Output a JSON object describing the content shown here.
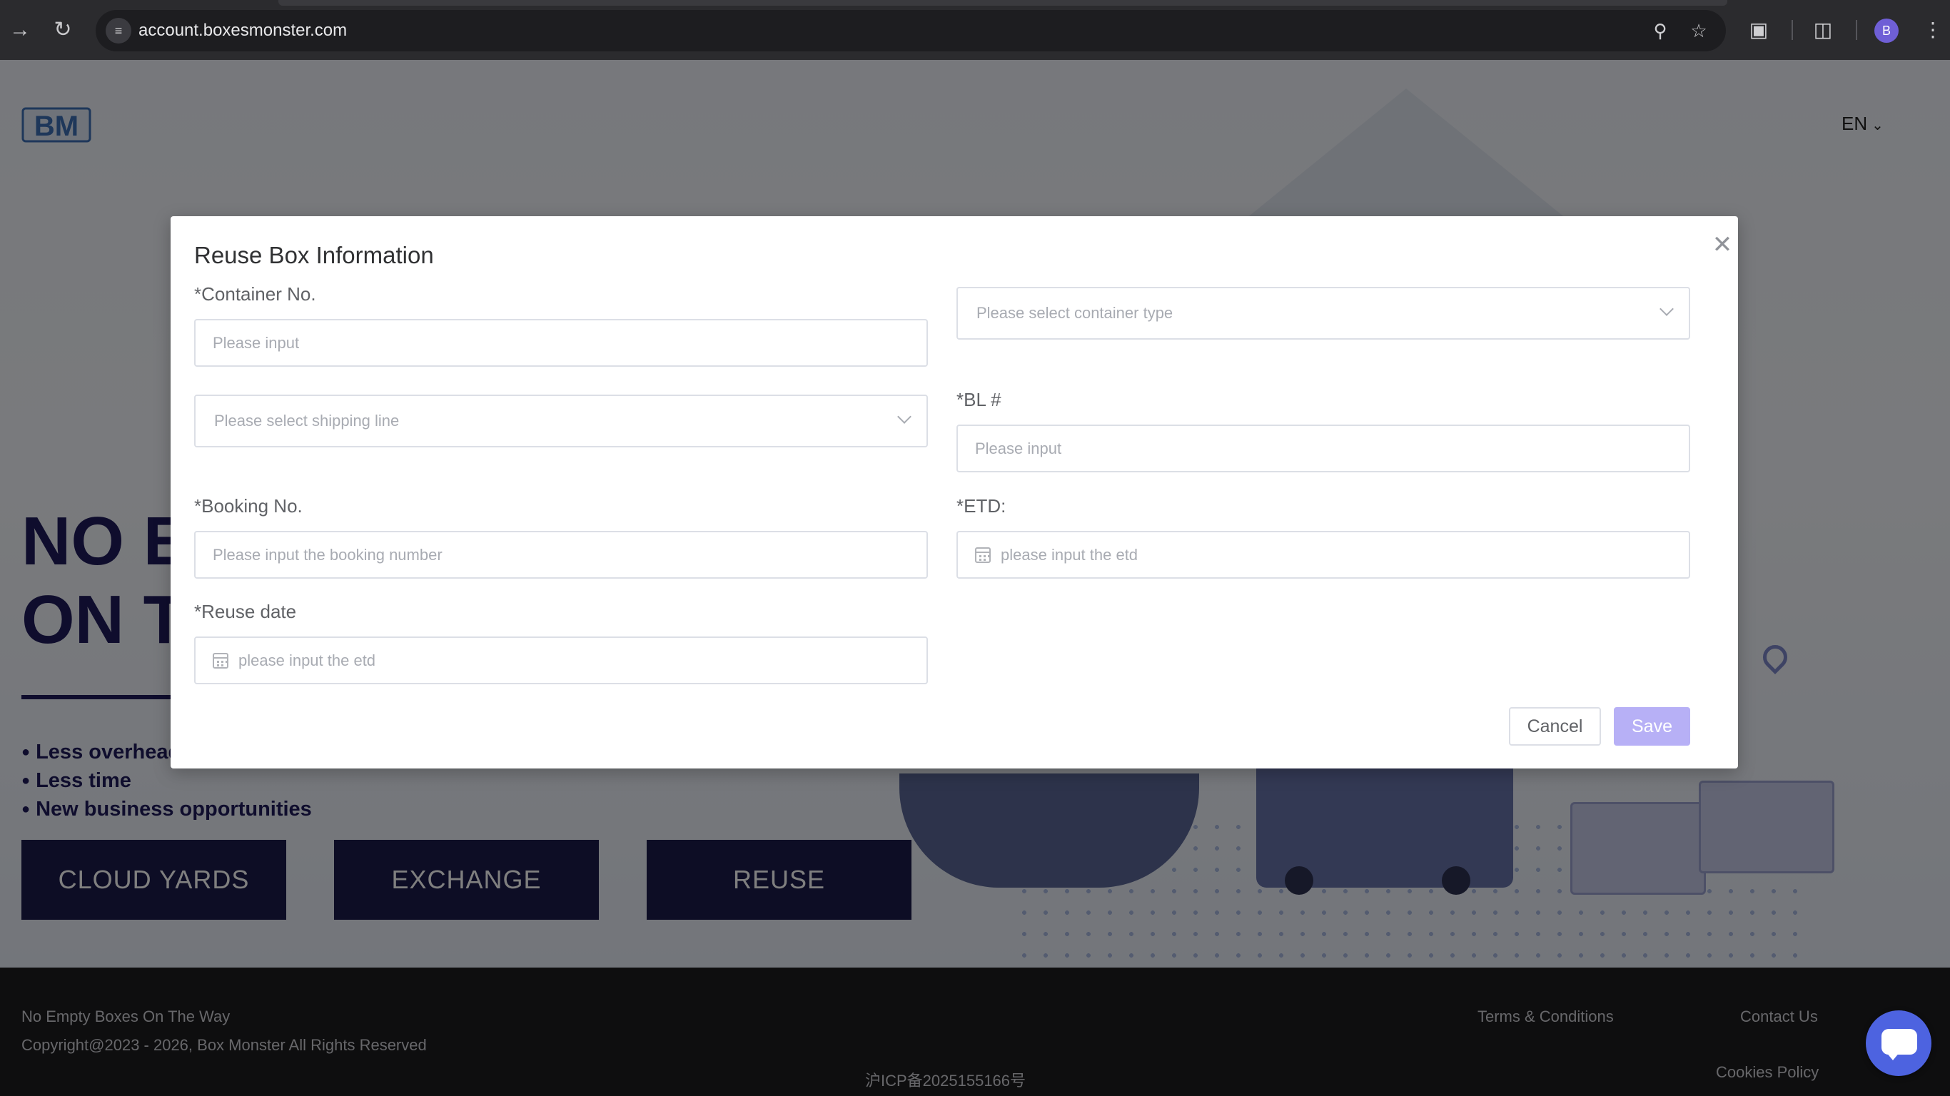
{
  "browser": {
    "url": "account.boxesmonster.com",
    "profile_initial": "B",
    "icons": [
      "forward-icon",
      "reload-icon",
      "site-info-icon",
      "password-key-icon",
      "bookmark-star-icon",
      "extensions-icon",
      "tab-search-icon",
      "menu-icon"
    ]
  },
  "header": {
    "logo_text": "BM",
    "language": "EN"
  },
  "hero": {
    "title_line1": "NO E",
    "title_line2": "ON T",
    "bullets": [
      "Less overhead",
      "Less time",
      "New business opportunities"
    ],
    "buttons": [
      "CLOUD YARDS",
      "EXCHANGE",
      "REUSE"
    ]
  },
  "footer": {
    "tagline": "No Empty Boxes On The Way",
    "copyright": "Copyright@2023 - 2026, Box Monster All Rights Reserved",
    "icp": "沪ICP备2025155166号",
    "links": {
      "terms": "Terms & Conditions",
      "contact": "Contact Us",
      "cookies": "Cookies Policy"
    }
  },
  "modal": {
    "title": "Reuse Box Information",
    "container_no": {
      "label": "*Container No.",
      "placeholder": "Please input",
      "value": ""
    },
    "container_type": {
      "placeholder": "Please select container type"
    },
    "shipping_line": {
      "placeholder": "Please select shipping line"
    },
    "bl": {
      "label": "*BL #",
      "placeholder": "Please input",
      "value": ""
    },
    "booking_no": {
      "label": "*Booking No.",
      "placeholder": "Please input the booking number",
      "value": ""
    },
    "etd": {
      "label": "*ETD:",
      "placeholder": "please input the etd",
      "value": ""
    },
    "reuse_date": {
      "label": "*Reuse date",
      "placeholder": "please input the etd",
      "value": ""
    },
    "cancel_label": "Cancel",
    "save_label": "Save"
  },
  "colors": {
    "brand_navy": "#1b1a4a",
    "save_button": "#b7b0f6",
    "chat_button": "#4d63e0"
  }
}
